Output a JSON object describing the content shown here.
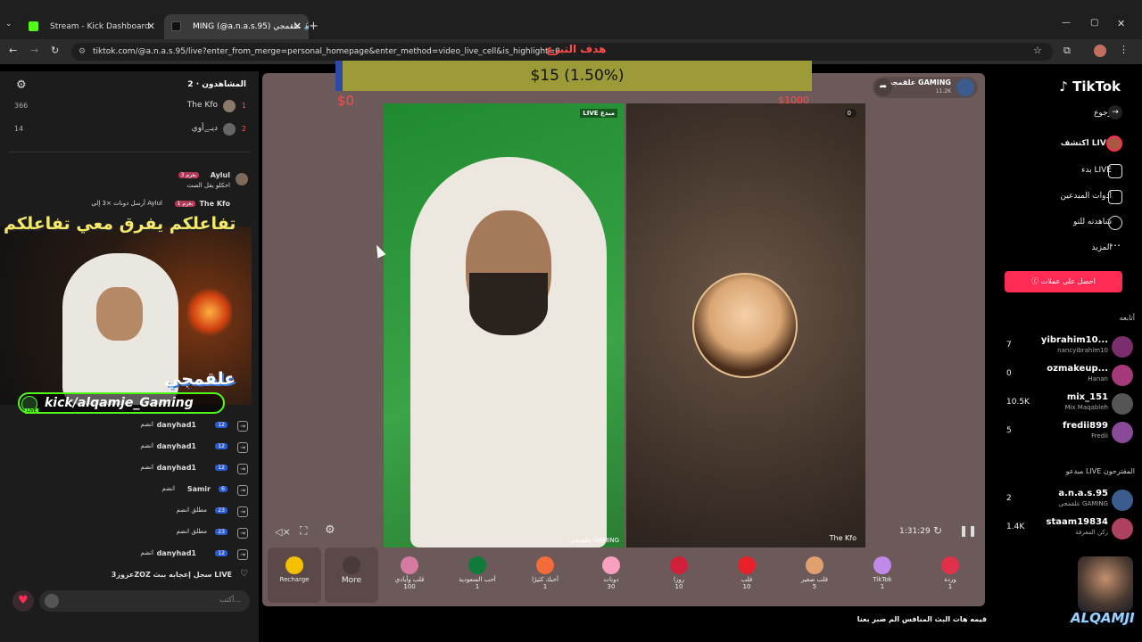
{
  "browser": {
    "tabs": [
      {
        "label": "Stream - Kick Dashboard"
      },
      {
        "label": "MING (@a.n.a.s.95) علقمجي 🔊"
      }
    ],
    "new_tab": "+",
    "url": "tiktok.com/@a.n.a.s.95/live?enter_from_merge=personal_homepage&enter_method=video_live_cell&is_highlight=0"
  },
  "viewers": {
    "title": "المشاهدون · 2",
    "list": [
      {
        "rank": "1",
        "name": "The Kfo",
        "count": "366"
      },
      {
        "rank": "2",
        "name": "ديـﮯأوي",
        "count": "14"
      }
    ]
  },
  "chat": {
    "items": [
      {
        "user": "Aylul",
        "badge": "بعرم 3",
        "text": "احكلو يقل الصت"
      },
      {
        "user": "The Kfo",
        "badge": "بعرم 1",
        "text": "أرسل دونات ×3 إلى Aylul"
      },
      {
        "user": "danyhad1",
        "badge": "12",
        "text": "انضم"
      },
      {
        "user": "danyhad1",
        "badge": "12",
        "text": "انضم"
      },
      {
        "user": "danyhad1",
        "badge": "12",
        "text": "انضم"
      },
      {
        "user": "Samir",
        "badge": "6",
        "text": "انضم"
      },
      {
        "user": "",
        "badge": "23",
        "text": "مطلق انضم"
      },
      {
        "user": "",
        "badge": "23",
        "text": "مطلق انضم"
      },
      {
        "user": "danyhad1",
        "badge": "12",
        "text": "انضم"
      }
    ],
    "footer_msg": "عزوز3ZOZ سجل إعجابه ببث LIVE",
    "input_placeholder": "أكتب..."
  },
  "overlay": {
    "banner": "تفاعلكم يفرق معي تفاعلكم",
    "brand": "علقمجي",
    "kick_link": "kick/alqamje_Gaming",
    "live_tag": "LIVE"
  },
  "goal": {
    "label": "هدف التبرع",
    "amount": "$15 (1.50%)",
    "min": "$0",
    "max": "$1000"
  },
  "streamer": {
    "name": "علقمجي GAMING",
    "followers": "11.2K"
  },
  "video": {
    "left_tag": "LIVE مبدع",
    "left_name": "علقمجي GAMING",
    "right_count": "0",
    "right_name": "The Kfo",
    "timer": "1:31:29"
  },
  "gifts": [
    {
      "name": "Recharge",
      "price": ""
    },
    {
      "name": "More",
      "price": ""
    },
    {
      "name": "قلب وأيادي",
      "price": "100"
    },
    {
      "name": "أحب السعودية",
      "price": "1"
    },
    {
      "name": "أحبك كثيرًا",
      "price": "1"
    },
    {
      "name": "دونات",
      "price": "30"
    },
    {
      "name": "روزا",
      "price": "10"
    },
    {
      "name": "قلب",
      "price": "10"
    },
    {
      "name": "قلب صغير",
      "price": "5"
    },
    {
      "name": "TikTok",
      "price": "1"
    },
    {
      "name": "وردة",
      "price": "1"
    }
  ],
  "tiktok": {
    "logo": "TikTok",
    "nav": [
      {
        "label": "رجوع"
      },
      {
        "label": "اكتشف LIVE"
      },
      {
        "label": "بدء LIVE"
      },
      {
        "label": "أدوات المبدعين"
      },
      {
        "label": "شاهدته للتو"
      },
      {
        "label": "المزيد"
      }
    ],
    "coins_btn": "احصل على عملات",
    "following_title": "أتابعه",
    "following": [
      {
        "name": "yibrahim10...",
        "sub": "nancyibrahim10",
        "count": "7"
      },
      {
        "name": "ozmakeup...",
        "sub": "Hanan",
        "count": "0"
      },
      {
        "name": "mix_151",
        "sub": "Mix Maqableh",
        "count": "10.5K"
      },
      {
        "name": "fredii899",
        "sub": "Fredii",
        "count": "5"
      }
    ],
    "suggested_title": "مبدعو LIVE المقترحون",
    "suggested": [
      {
        "name": "a.n.a.s.95",
        "sub": "علقمجي GAMING",
        "count": "2"
      },
      {
        "name": "staam19834",
        "sub": "ركن المعرفة",
        "count": "1.4K"
      }
    ]
  },
  "caption": "قيمه هات البث المنافس  الم صبر بعنا",
  "watermark": "ALQAMJI"
}
